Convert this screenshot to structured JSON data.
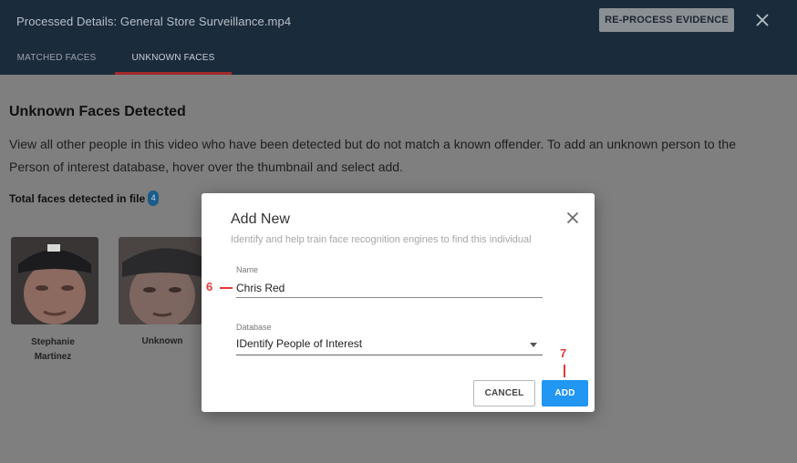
{
  "header": {
    "title": "Processed Details: General Store Surveillance.mp4",
    "reprocess_label": "RE-PROCESS EVIDENCE",
    "close_icon": "close-icon"
  },
  "tabs": [
    {
      "label": "MATCHED FACES",
      "active": false
    },
    {
      "label": "UNKNOWN FACES",
      "active": true
    }
  ],
  "colors": {
    "header_bg": "#1a2b3c",
    "tab_underline": "#a52a2a",
    "primary_button": "#2196f3",
    "callout": "#e53935",
    "badge": "#1a5c8a"
  },
  "content": {
    "title": "Unknown Faces Detected",
    "description": "View all other people in this video who have been detected but do not match a known offender. To add an unknown person to the Person of interest database, hover over the thumbnail and select add.",
    "total_label": "Total faces detected in file",
    "total_count": "4"
  },
  "faces": [
    {
      "name": "Stephanie\nMartinez"
    },
    {
      "name": "Unknown"
    }
  ],
  "modal": {
    "title": "Add New",
    "subtitle": "Identify and help train face recognition engines to find this individual",
    "name_label": "Name",
    "name_value": "Chris Red",
    "database_label": "Database",
    "database_value": "IDentify People of Interest",
    "cancel_label": "CANCEL",
    "add_label": "ADD"
  },
  "callouts": {
    "name_step": "6",
    "add_step": "7"
  }
}
